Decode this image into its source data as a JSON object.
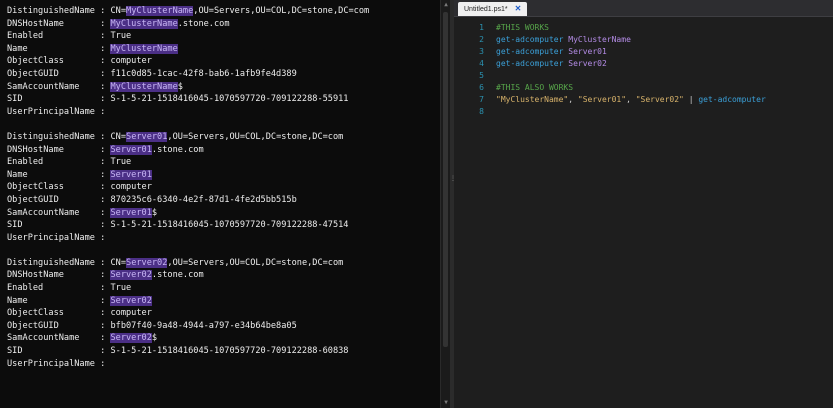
{
  "console": {
    "blocks": [
      {
        "lines": [
          {
            "label": "DistinguishedName",
            "pre": "CN=",
            "hl": "MyClusterName",
            "post": ",OU=Servers,OU=COL,DC=stone,DC=com"
          },
          {
            "label": "DNSHostName",
            "pre": "",
            "hl": "MyClusterName",
            "post": ".stone.com"
          },
          {
            "label": "Enabled",
            "pre": "True",
            "hl": "",
            "post": ""
          },
          {
            "label": "Name",
            "pre": "",
            "hl": "MyClusterName",
            "post": ""
          },
          {
            "label": "ObjectClass",
            "pre": "computer",
            "hl": "",
            "post": ""
          },
          {
            "label": "ObjectGUID",
            "pre": "f11c0d85-1cac-42f8-bab6-1afb9fe4d389",
            "hl": "",
            "post": ""
          },
          {
            "label": "SamAccountName",
            "pre": "",
            "hl": "MyClusterName",
            "post": "$"
          },
          {
            "label": "SID",
            "pre": "S-1-5-21-1518416045-1070597720-709122288-55911",
            "hl": "",
            "post": ""
          },
          {
            "label": "UserPrincipalName",
            "pre": "",
            "hl": "",
            "post": ""
          }
        ]
      },
      {
        "lines": [
          {
            "label": "DistinguishedName",
            "pre": "CN=",
            "hl": "Server01",
            "post": ",OU=Servers,OU=COL,DC=stone,DC=com"
          },
          {
            "label": "DNSHostName",
            "pre": "",
            "hl": "Server01",
            "post": ".stone.com"
          },
          {
            "label": "Enabled",
            "pre": "True",
            "hl": "",
            "post": ""
          },
          {
            "label": "Name",
            "pre": "",
            "hl": "Server01",
            "post": ""
          },
          {
            "label": "ObjectClass",
            "pre": "computer",
            "hl": "",
            "post": ""
          },
          {
            "label": "ObjectGUID",
            "pre": "870235c6-6340-4e2f-87d1-4fe2d5bb515b",
            "hl": "",
            "post": ""
          },
          {
            "label": "SamAccountName",
            "pre": "",
            "hl": "Server01",
            "post": "$"
          },
          {
            "label": "SID",
            "pre": "S-1-5-21-1518416045-1070597720-709122288-47514",
            "hl": "",
            "post": ""
          },
          {
            "label": "UserPrincipalName",
            "pre": "",
            "hl": "",
            "post": ""
          }
        ]
      },
      {
        "lines": [
          {
            "label": "DistinguishedName",
            "pre": "CN=",
            "hl": "Server02",
            "post": ",OU=Servers,OU=COL,DC=stone,DC=com"
          },
          {
            "label": "DNSHostName",
            "pre": "",
            "hl": "Server02",
            "post": ".stone.com"
          },
          {
            "label": "Enabled",
            "pre": "True",
            "hl": "",
            "post": ""
          },
          {
            "label": "Name",
            "pre": "",
            "hl": "Server02",
            "post": ""
          },
          {
            "label": "ObjectClass",
            "pre": "computer",
            "hl": "",
            "post": ""
          },
          {
            "label": "ObjectGUID",
            "pre": "bfb07f40-9a48-4944-a797-e34b64be8a05",
            "hl": "",
            "post": ""
          },
          {
            "label": "SamAccountName",
            "pre": "",
            "hl": "Server02",
            "post": "$"
          },
          {
            "label": "SID",
            "pre": "S-1-5-21-1518416045-1070597720-709122288-60838",
            "hl": "",
            "post": ""
          },
          {
            "label": "UserPrincipalName",
            "pre": "",
            "hl": "",
            "post": ""
          }
        ]
      }
    ]
  },
  "editor": {
    "tab": {
      "title": "Untitled1.ps1*",
      "close": "✕"
    },
    "lines": [
      {
        "num": "1",
        "tokens": [
          {
            "t": "#THIS WORKS",
            "c": "comment"
          }
        ]
      },
      {
        "num": "2",
        "tokens": [
          {
            "t": "get-adcomputer",
            "c": "cmdlet"
          },
          {
            "t": " ",
            "c": "plain"
          },
          {
            "t": "MyClusterName",
            "c": "arg"
          }
        ]
      },
      {
        "num": "3",
        "tokens": [
          {
            "t": "get-adcomputer",
            "c": "cmdlet"
          },
          {
            "t": " ",
            "c": "plain"
          },
          {
            "t": "Server01",
            "c": "arg"
          }
        ]
      },
      {
        "num": "4",
        "tokens": [
          {
            "t": "get-adcomputer",
            "c": "cmdlet"
          },
          {
            "t": " ",
            "c": "plain"
          },
          {
            "t": "Server02",
            "c": "arg"
          }
        ]
      },
      {
        "num": "5",
        "tokens": []
      },
      {
        "num": "6",
        "tokens": [
          {
            "t": "#THIS ALSO WORKS",
            "c": "comment"
          }
        ]
      },
      {
        "num": "7",
        "tokens": [
          {
            "t": "\"MyClusterName\"",
            "c": "str"
          },
          {
            "t": ", ",
            "c": "plain"
          },
          {
            "t": "\"Server01\"",
            "c": "str"
          },
          {
            "t": ", ",
            "c": "plain"
          },
          {
            "t": "\"Server02\"",
            "c": "str"
          },
          {
            "t": " | ",
            "c": "plain"
          },
          {
            "t": "get-adcomputer",
            "c": "cmdlet"
          }
        ]
      },
      {
        "num": "8",
        "tokens": []
      }
    ]
  },
  "colors": {
    "console_bg": "#0c0c0c",
    "highlight_bg": "#4b2f86",
    "comment": "#57a64a",
    "cmdlet": "#3ba0d8",
    "argument": "#b48ce6",
    "string": "#d8b36b",
    "line_number": "#2b91af"
  },
  "icons": {
    "scroll_up": "▲",
    "scroll_down": "▼",
    "splitter_grip": "⋮"
  }
}
